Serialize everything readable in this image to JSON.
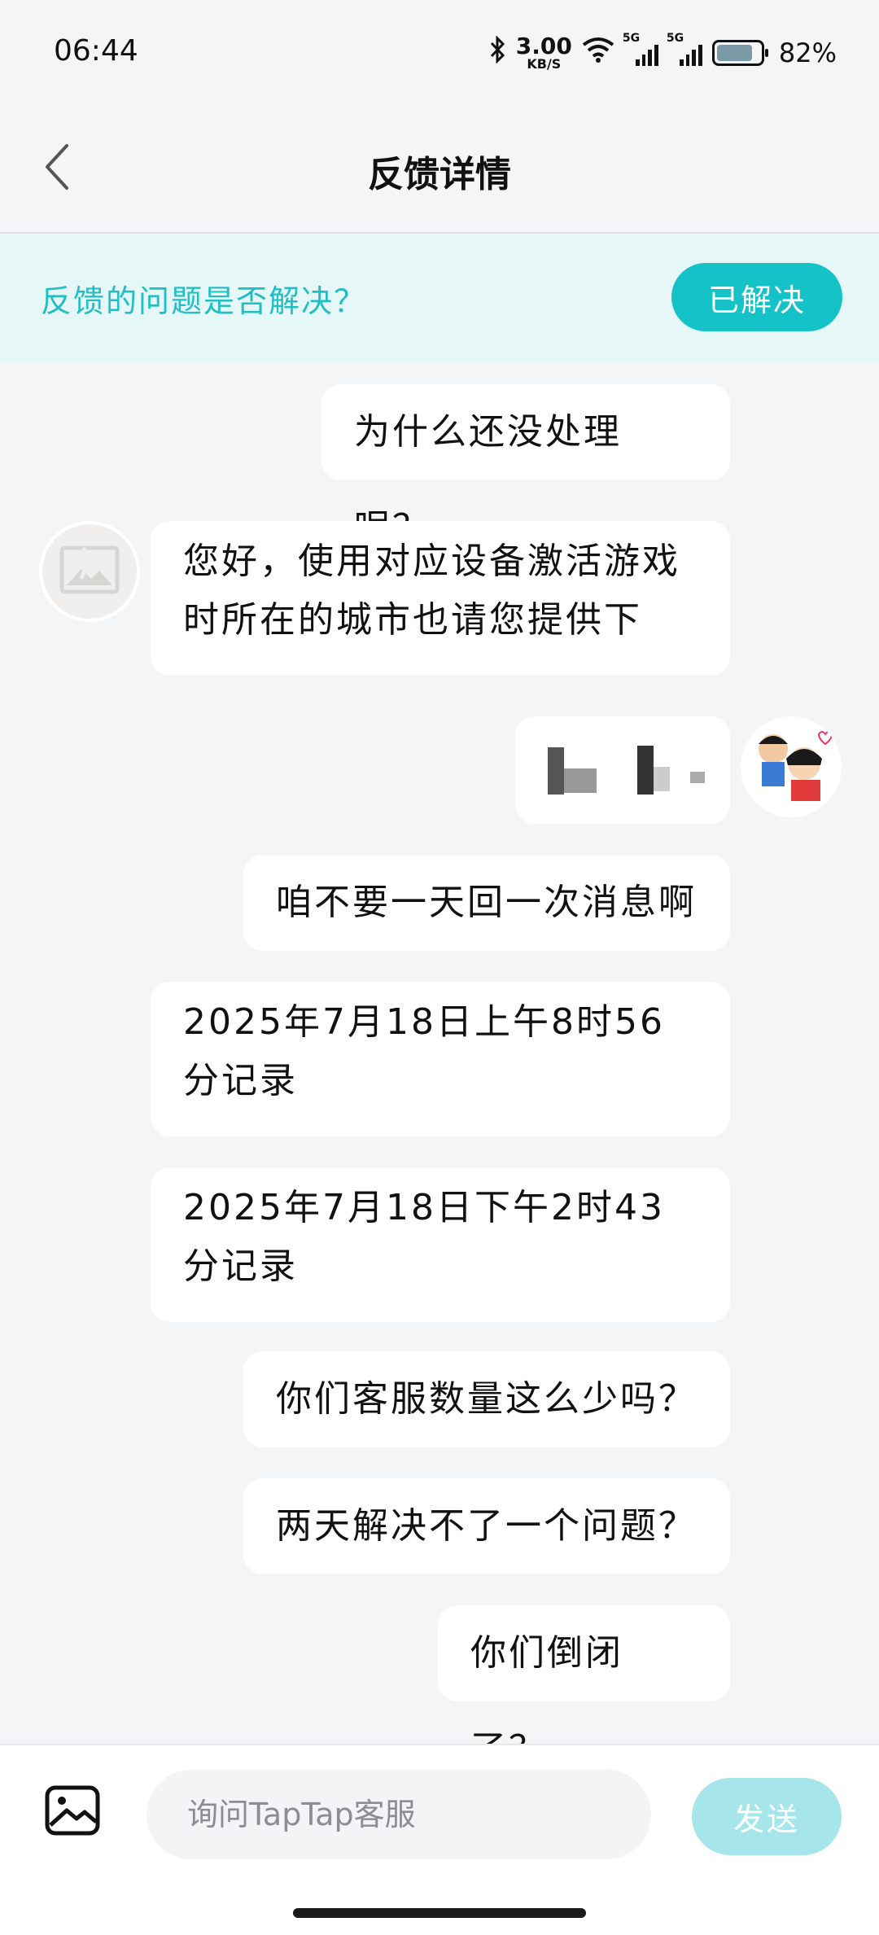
{
  "status_bar": {
    "time": "06:44",
    "net_speed_value": "3.00",
    "net_speed_unit": "KB/S",
    "sim1_label": "5G",
    "sim2_label": "5G",
    "battery_percent": "82%"
  },
  "header": {
    "title": "反馈详情"
  },
  "resolve_banner": {
    "question": "反馈的问题是否解决？",
    "button_label": "已解决"
  },
  "messages": [
    {
      "sender": "user",
      "text": "为什么还没处理呢？"
    },
    {
      "sender": "agent",
      "text": "您好，使用对应设备激活游戏时所在的城市也请您提供下"
    },
    {
      "sender": "user",
      "text": "",
      "redacted": true
    },
    {
      "sender": "user",
      "text": "咱不要一天回一次消息啊"
    },
    {
      "sender": "system",
      "text": "2025年7月18日上午8时56分记录"
    },
    {
      "sender": "system",
      "text": "2025年7月18日下午2时43分记录"
    },
    {
      "sender": "user",
      "text": "你们客服数量这么少吗？"
    },
    {
      "sender": "user",
      "text": "两天解决不了一个问题？"
    },
    {
      "sender": "user",
      "text": "你们倒闭了？"
    }
  ],
  "input_bar": {
    "placeholder": "询问TapTap客服",
    "send_label": "发送"
  },
  "colors": {
    "accent": "#15c2c8",
    "banner_bg": "#e6f7f8",
    "send_disabled": "#a6e6ea"
  }
}
